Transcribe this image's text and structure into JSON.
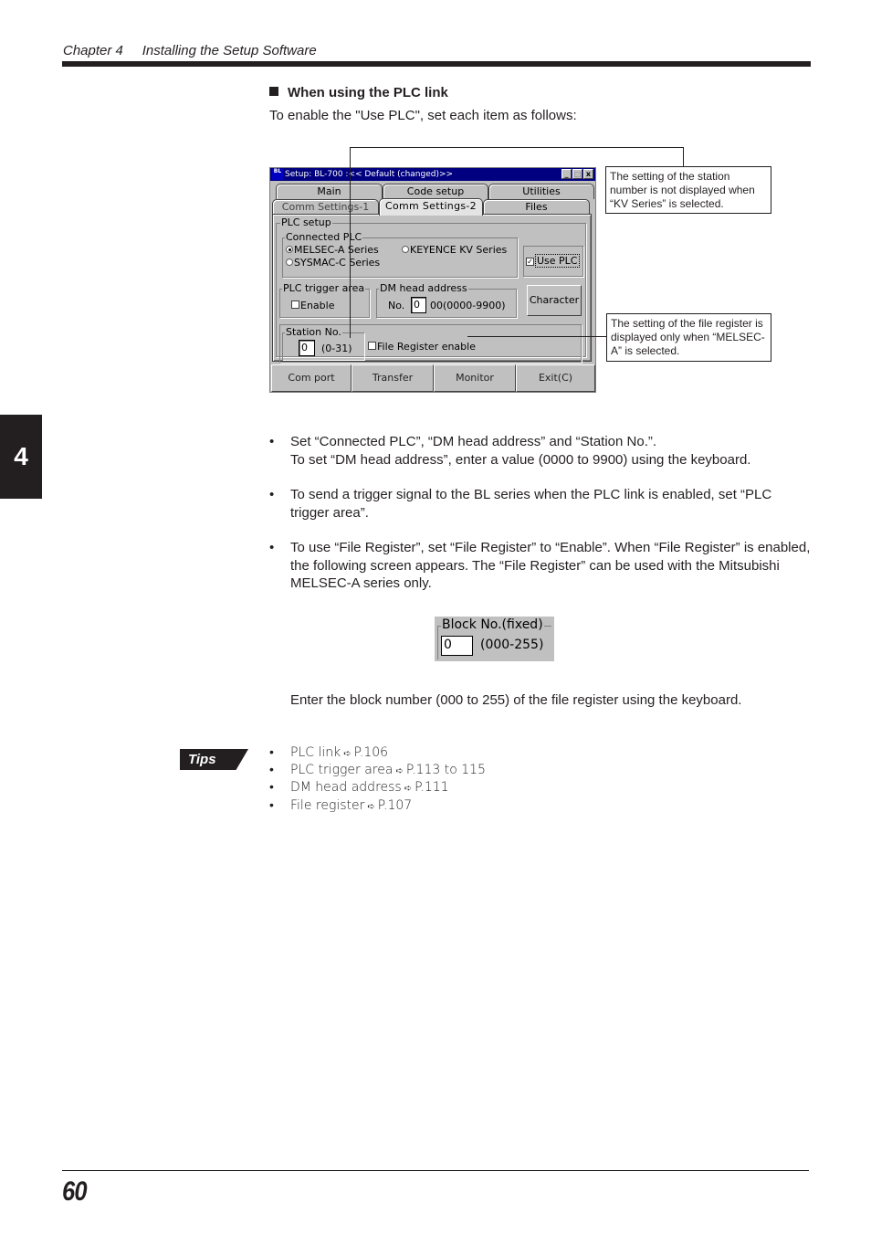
{
  "header": {
    "chapter": "Chapter 4",
    "title": "Installing the Setup Software"
  },
  "side_tab": {
    "label": "4"
  },
  "section": {
    "heading": "When using the PLC link",
    "intro": "To enable the \"Use PLC\", set each item as follows:"
  },
  "dialog": {
    "title": "Setup: BL-700 :<< Default (changed)>>",
    "app_icon": "BL",
    "title_buttons": {
      "minimize": "_",
      "maximize": "□",
      "close": "x"
    },
    "tabs_row1": [
      "Main",
      "Code setup",
      "Utilities"
    ],
    "tabs_row2": [
      "Comm Settings-1",
      "Comm Settings-2",
      "Files"
    ],
    "selected_tab": "Comm Settings-2",
    "plc_setup": {
      "title": "PLC setup",
      "connected_plc": {
        "title": "Connected PLC",
        "options": [
          "MELSEC-A Series",
          "KEYENCE KV Series",
          "SYSMAC-C Series"
        ],
        "selected": "MELSEC-A Series"
      },
      "use_plc": {
        "label": "Use PLC",
        "checked": true
      },
      "trigger_area": {
        "title": "PLC trigger area",
        "enable_label": "Enable",
        "checked": false
      },
      "dm_head": {
        "title": "DM head address",
        "no_label": "No.",
        "value": "0",
        "suffix": "00(0000-9900)"
      },
      "character_button": "Character",
      "station": {
        "title": "Station No.",
        "value": "0",
        "range": "(0-31)"
      },
      "file_register": {
        "label": "File Register enable",
        "checked": false
      }
    },
    "bottom_buttons": [
      "Com port",
      "Transfer",
      "Monitor",
      "Exit(C)"
    ]
  },
  "callouts": {
    "station": "The setting of the station number is not displayed when “KV Series” is selected.",
    "file_register": "The setting of the file register is displayed only when “MELSEC-A” is selected."
  },
  "bullets": [
    {
      "line1": "Set “Connected PLC”, “DM head address” and “Station No.”.",
      "line2": "To set “DM head address”, enter a value (0000 to 9900) using the keyboard."
    },
    {
      "text": "To send a trigger signal to the BL series when the PLC link is enabled, set “PLC trigger area”."
    },
    {
      "text": "To use “File Register”, set “File Register” to “Enable”. When “File Register” is enabled, the following screen appears. The “File Register” can be used with the Mitsubishi MELSEC-A series only."
    }
  ],
  "block_no": {
    "title": "Block No.(fixed)",
    "value": "0",
    "range": "(000-255)"
  },
  "enter_text": "Enter the block number (000 to 255) of the file register using the keyboard.",
  "tips": {
    "badge": "Tips",
    "items": [
      {
        "label": "PLC link",
        "ref": "P.106"
      },
      {
        "label": "PLC trigger area",
        "ref": "P.113 to 115"
      },
      {
        "label": "DM head address",
        "ref": "P.111"
      },
      {
        "label": "File register",
        "ref": "P.107"
      }
    ]
  },
  "footer": {
    "page_number": "60"
  },
  "glyphs": {
    "bullet": "•",
    "ref_arrow": "➪",
    "check": "✓"
  }
}
